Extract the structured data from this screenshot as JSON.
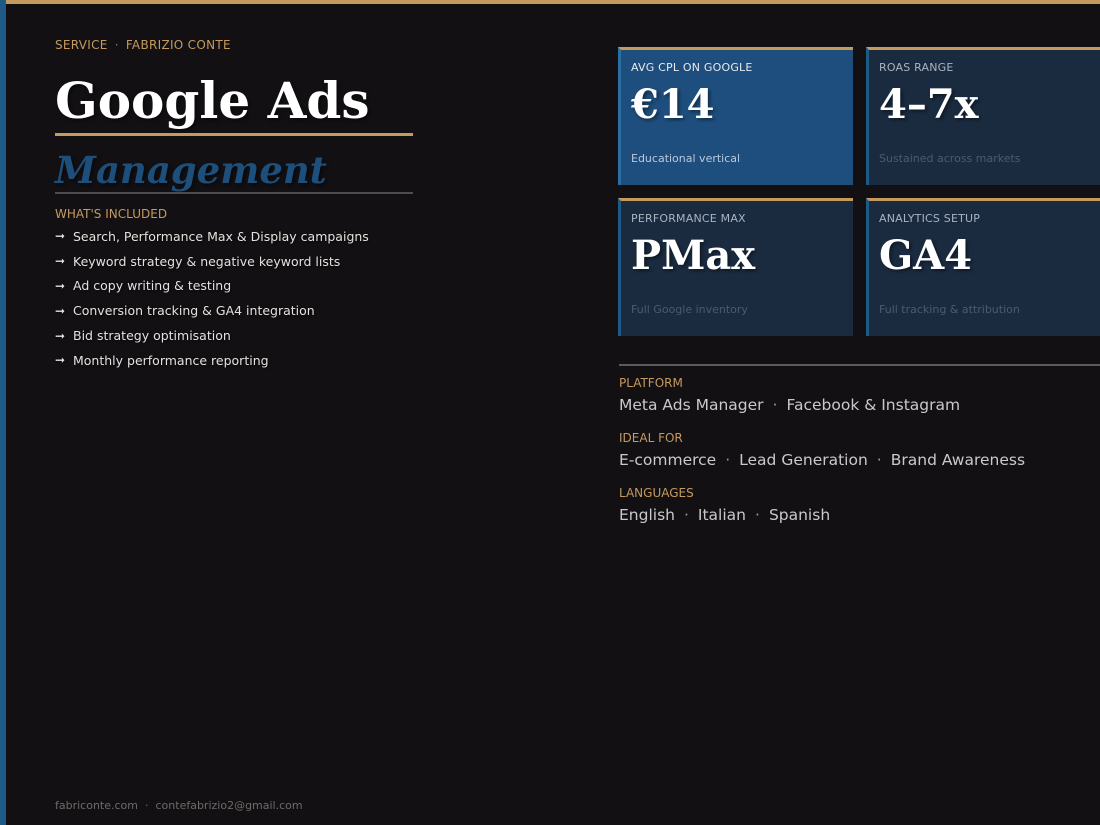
{
  "header": {
    "eyebrow_service": "SERVICE",
    "eyebrow_name": "FABRIZIO CONTE",
    "title": "Google Ads",
    "subtitle": "Management"
  },
  "included": {
    "label": "WHAT'S INCLUDED",
    "items": [
      "Search, Performance Max & Display campaigns",
      "Keyword strategy & negative keyword lists",
      "Ad copy writing & testing",
      "Conversion tracking & GA4 integration",
      "Bid strategy optimisation",
      "Monthly performance reporting"
    ]
  },
  "cards": [
    {
      "label": "AVG CPL ON GOOGLE",
      "value": "€14",
      "note": "Educational vertical"
    },
    {
      "label": "ROAS RANGE",
      "value": "4–7x",
      "note": "Sustained across markets"
    },
    {
      "label": "PERFORMANCE MAX",
      "value": "PMax",
      "note": "Full Google inventory"
    },
    {
      "label": "ANALYTICS SETUP",
      "value": "GA4",
      "note": "Full tracking & attribution"
    }
  ],
  "meta": {
    "platform": {
      "label": "PLATFORM",
      "values": [
        "Meta Ads Manager",
        "Facebook & Instagram"
      ]
    },
    "ideal_for": {
      "label": "IDEAL FOR",
      "values": [
        "E-commerce",
        "Lead Generation",
        "Brand Awareness"
      ]
    },
    "languages": {
      "label": "LANGUAGES",
      "values": [
        "English",
        "Italian",
        "Spanish"
      ]
    }
  },
  "footer": {
    "website": "fabriconte.com",
    "email": "contefabrizio2@gmail.com"
  },
  "colors": {
    "background": "#121013",
    "accent_gold": "#c59a5e",
    "accent_blue": "#1e5a86",
    "card_bg": "#1a2b40",
    "card_highlight_bg": "#1e4e7d"
  },
  "icons": {
    "list_bullet": "arrow-right-icon",
    "separator": "middle-dot"
  }
}
